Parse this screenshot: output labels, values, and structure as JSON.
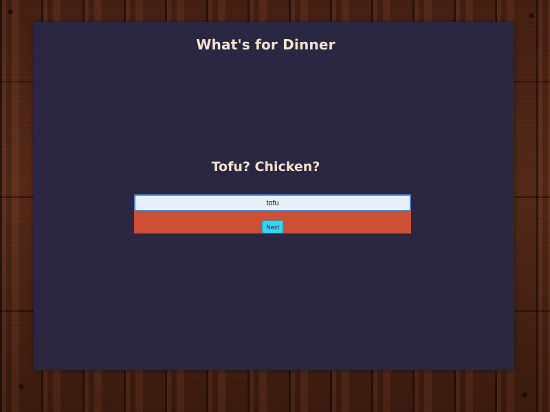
{
  "app": {
    "title": "What's for Dinner"
  },
  "prompt": {
    "question": "Tofu? Chicken?"
  },
  "form": {
    "input_value": "tofu",
    "next_label": "Next",
    "form_background_color": "#cc5134",
    "button_color": "#3cd0f1"
  },
  "theme": {
    "panel_color": "#292741",
    "heading_color": "#f7e3c9",
    "background": "wood planks"
  }
}
